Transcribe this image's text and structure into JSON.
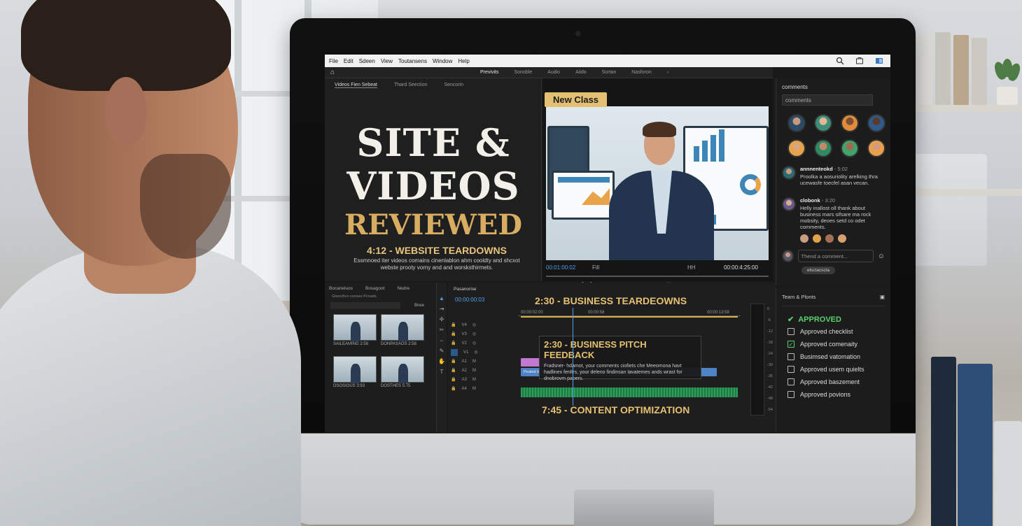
{
  "menu": {
    "items": [
      "File",
      "Edit",
      "Sdeen",
      "View",
      "Toutansens",
      "Window",
      "Help"
    ]
  },
  "toolbar": {
    "tabs": [
      "Previvits",
      "Sonoble",
      "Audio",
      "Aiido",
      "Sortan",
      "Nasforon"
    ],
    "more": "›"
  },
  "promo": {
    "tabs": [
      "Videos Fien Sebeat",
      "Thard Seection",
      "Sencorin"
    ],
    "title_line1": "SITE &",
    "title_line2": "VIDEOS",
    "title_line3": "REVIEWED",
    "subtitle": "4:12 - WEBSITE TEARDOWNS",
    "description": "Essmnoed iter videos comains cinenlablon ahm cooldty and shcxot webste prooty vorny and and worsksthirmets."
  },
  "preview": {
    "badge": "New Class",
    "timecode_left": "00:01:00:02",
    "fit": "Fill",
    "quality": "HH",
    "timecode_right": "00:00:4:25:00"
  },
  "comments": {
    "header": "comments",
    "search_placeholder": "comments",
    "thread": [
      {
        "name": "annnenteokd",
        "time": "- 5:02",
        "text": "Proolka a aosuriolity arelking thra ucewasfe toecfel asan vecan."
      },
      {
        "name": "clobonk",
        "time": "- 3:20",
        "text": "Helly inallost oll thank about business mars sifsare ma rock mobsity, deoes setd co odet comments."
      }
    ],
    "reply_placeholder": "Thend a comment...",
    "chip": "elsctacscta"
  },
  "media": {
    "tabs": [
      "Bocaneluos",
      "Bosagoot",
      "Nedre"
    ],
    "path": "Gtsocthcn conses Pcoads",
    "list_label": "Bnee",
    "thumbs": [
      {
        "label": "SAILEAMING",
        "meta": "2:58"
      },
      {
        "label": "DONPASAOS",
        "meta": "2:58"
      },
      {
        "label": "DSOSIOUS",
        "meta": "3:93"
      },
      {
        "label": "DOSTHES",
        "meta": "5:75"
      }
    ]
  },
  "timeline": {
    "title": "Pasanorise",
    "timecode": "00:00:00:03",
    "ruler": [
      "00:00:02:00",
      "00:00:58",
      "00:00:13:58"
    ],
    "marker1": "2:30 - BUSINESS TEARDEOWNS",
    "feedback_title": "2:30 - BUSINESS PITCH FEEDBACK",
    "feedback_body": "Fradsner- hdamot, your comments ciofiets che Meeomona havt hadlinex fenltrs, your deleno findinsan tavatemes ands wrast for dnobrovm papers.",
    "clip_label": "Peated fa uniaenaco Conscinum Foedaagy",
    "marker2": "7:45 - CONTENT OPTIMIZATION",
    "scale": [
      "0",
      "-6",
      "-12",
      "-18",
      "-24",
      "-30",
      "-36",
      "-42",
      "-48",
      "-54"
    ]
  },
  "approval": {
    "header": "Team & Plonts",
    "status": "APPROVED",
    "items": [
      {
        "label": "Approved checklist",
        "checked": false
      },
      {
        "label": "Approved comenaity",
        "checked": true
      },
      {
        "label": "Busimsed vatomation",
        "checked": false
      },
      {
        "label": "Approved usem quielts",
        "checked": false
      },
      {
        "label": "Approved baszement",
        "checked": false
      },
      {
        "label": "Approved povions",
        "checked": false
      }
    ]
  },
  "colors": {
    "accent_gold": "#d8ad62",
    "badge": "#e4c072",
    "approved_green": "#5bd06d",
    "timecode_blue": "#4ea0e6"
  }
}
